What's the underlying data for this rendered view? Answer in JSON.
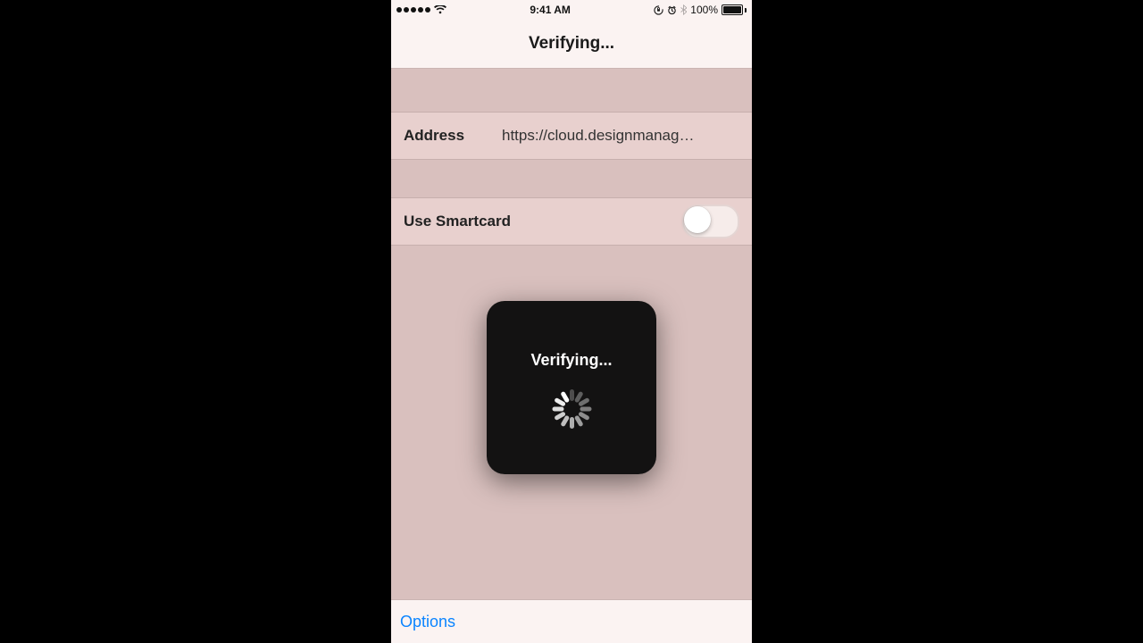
{
  "status_bar": {
    "time": "9:41 AM",
    "battery_pct": "100%",
    "signal_dots": 5,
    "wifi": true,
    "orientation_lock": true,
    "alarm": true,
    "bluetooth": true
  },
  "header": {
    "title": "Verifying..."
  },
  "form": {
    "address_label": "Address",
    "address_value": "https://cloud.designmanag…",
    "smartcard_label": "Use Smartcard",
    "smartcard_on": false
  },
  "hud": {
    "message": "Verifying..."
  },
  "toolbar": {
    "options_label": "Options"
  },
  "colors": {
    "accent_link": "#0a84ff",
    "bg_content": "#d9c0be",
    "bg_row": "#e8d0ce",
    "bg_chrome": "#fbf3f2"
  }
}
